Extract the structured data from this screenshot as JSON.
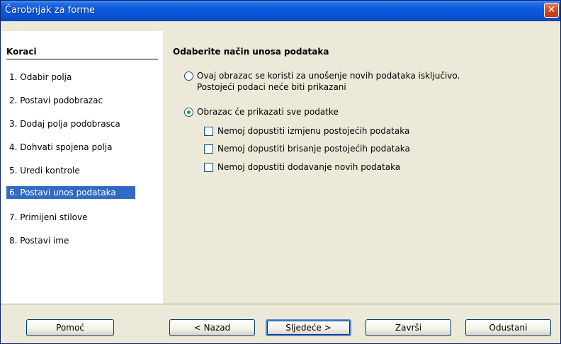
{
  "window": {
    "title": "Čarobnjak za forme"
  },
  "steps": {
    "heading": "Koraci",
    "items": [
      {
        "label": "1.  Odabir polja"
      },
      {
        "label": "2.  Postavi podobrazac"
      },
      {
        "label": "3.  Dodaj polja podobrasca"
      },
      {
        "label": "4.  Dohvati spojena polja"
      },
      {
        "label": "5.  Uredi kontrole"
      },
      {
        "label": "6.  Postavi unos podataka"
      },
      {
        "label": "7.  Primijeni stilove"
      },
      {
        "label": "8.  Postavi ime"
      }
    ],
    "selected_index": 5
  },
  "main": {
    "heading": "Odaberite način unosa podataka",
    "radio_new_only": {
      "line1": "Ovaj obrazac se koristi za unošenje novih podataka isključivo.",
      "line2": "Postojeći podaci neće biti prikazani",
      "checked": false
    },
    "radio_all_data": {
      "label": "Obrazac će prikazati sve podatke",
      "checked": true
    },
    "checkboxes": [
      {
        "label": "Nemoj dopustiti izmjenu postojećih podataka",
        "checked": false
      },
      {
        "label": "Nemoj dopustiti brisanje postojećih podataka",
        "checked": false
      },
      {
        "label": "Nemoj dopustiti dodavanje novih podataka",
        "checked": false
      }
    ]
  },
  "buttons": {
    "help": "Pomoć",
    "back": "< Nazad",
    "next": "Sljedeće >",
    "finish": "Završi",
    "cancel": "Odustani"
  },
  "icons": {
    "close": "close-icon"
  },
  "colors": {
    "title_bar": "#0a58de",
    "selection": "#316ac5",
    "dialog_bg": "#ece9d8",
    "radio_dot": "#21a121"
  }
}
